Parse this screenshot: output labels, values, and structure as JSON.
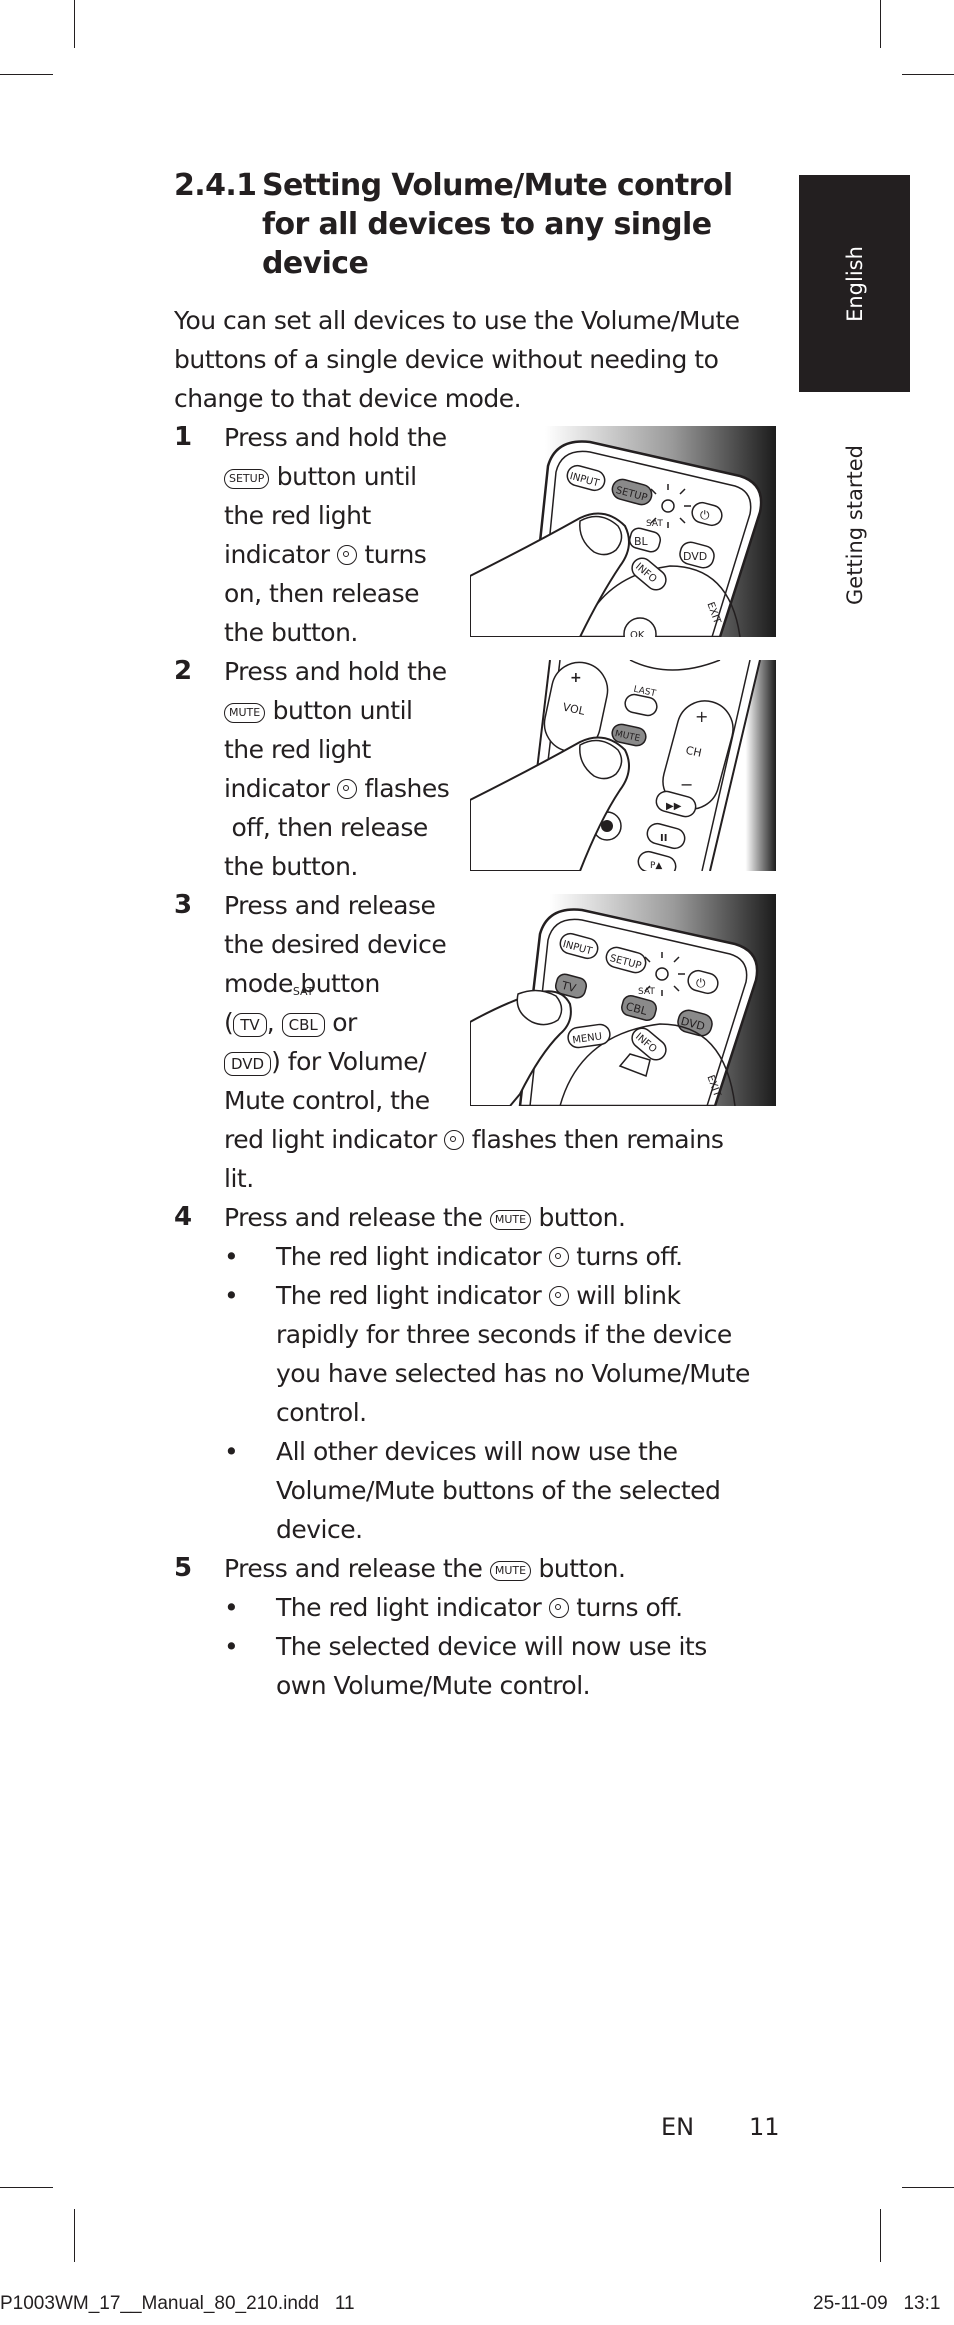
{
  "section": {
    "number": "2.4.1",
    "title": "Setting Volume/Mute control for all devices to any single device",
    "intro": "You can set all devices to use the Volume/Mute buttons of a single device without needing to change to that device mode."
  },
  "side_tabs": {
    "language": "English",
    "chapter": "Getting started"
  },
  "keys": {
    "setup": "SETUP",
    "mute": "MUTE",
    "tv": "TV",
    "cbl": "CBL",
    "sat": "SAT",
    "dvd": "DVD"
  },
  "steps": [
    {
      "number": "1",
      "lines": [
        "Press and hold the",
        "button until",
        "the red light",
        "indicator",
        "turns",
        "on, then release",
        "the button."
      ]
    },
    {
      "number": "2",
      "lines": [
        "Press and hold the",
        "button until",
        "the red light",
        "indicator",
        "flashes",
        " off, then release",
        "the button."
      ]
    },
    {
      "number": "3",
      "lines": [
        "Press and release",
        "the desired device",
        "mode button",
        "(",
        ",",
        "or",
        ") for Volume/",
        "Mute control, the",
        "red light indicator",
        "flashes then remains",
        "lit."
      ]
    },
    {
      "number": "4",
      "lead_before": "Press and release the",
      "lead_after": "button.",
      "bullets": [
        {
          "before": "The red light indicator",
          "after": "turns off."
        },
        {
          "before": "The red light indicator",
          "after": "will blink",
          "cont": [
            "rapidly for three seconds if the device",
            "you have selected has no Volume/Mute",
            "control."
          ]
        },
        {
          "text": [
            "All other devices will now use the",
            "Volume/Mute buttons of the selected",
            "device."
          ]
        }
      ]
    },
    {
      "number": "5",
      "lead_before": "Press and release the",
      "lead_after": "button.",
      "bullets": [
        {
          "before": "The red light indicator",
          "after": "turns off."
        },
        {
          "text": [
            "The selected device will now use its",
            "own Volume/Mute control."
          ]
        }
      ]
    }
  ],
  "illustrations": [
    {
      "caption": "remote-press-setup",
      "labels": [
        "INPUT",
        "SETUP",
        "SAT",
        "BL",
        "DVD",
        "INFO",
        "EXIT",
        "OK"
      ]
    },
    {
      "caption": "remote-press-mute",
      "labels": [
        "VOL",
        "LAST",
        "MUTE",
        "CH",
        "+",
        "−",
        "P▲"
      ]
    },
    {
      "caption": "remote-press-tv",
      "labels": [
        "INPUT",
        "SETUP",
        "TV",
        "SAT",
        "CBL",
        "DVD",
        "MENU",
        "INFO",
        "EXIT"
      ]
    }
  ],
  "bullet_char": "•",
  "footer": {
    "language_code": "EN",
    "page_number": "11"
  },
  "print_slug": {
    "file": "P1003WM_17__Manual_80_210.indd   11",
    "date": "25-11-09   13:1"
  },
  "colors": {
    "ink": "#231f20",
    "tab_background": "#231f20",
    "button_pressed": "#8a8a8a"
  }
}
